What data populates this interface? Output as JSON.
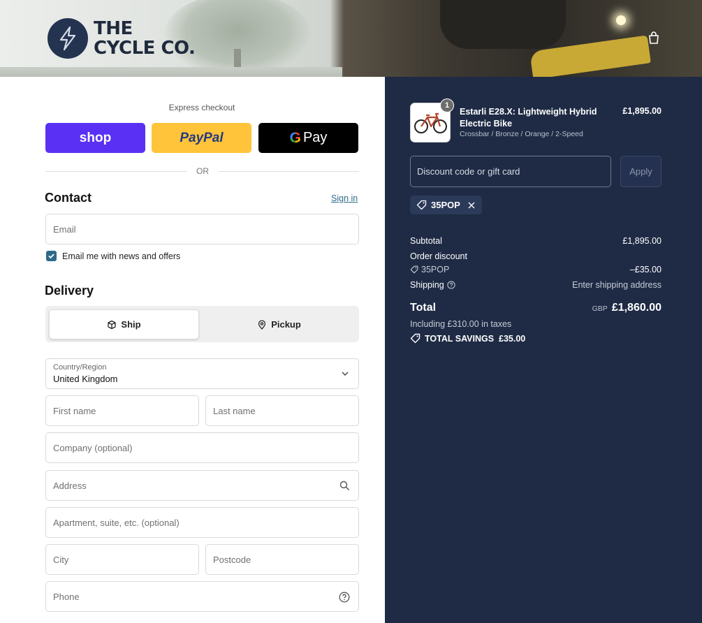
{
  "header": {
    "logo_line1": "THE",
    "logo_line2": "CYCLE CO."
  },
  "express": {
    "title": "Express checkout",
    "shop_label": "shop",
    "paypal_label": "PayPal",
    "gpay_label": "Pay",
    "or_label": "OR"
  },
  "contact": {
    "heading": "Contact",
    "signin": "Sign in",
    "email_placeholder": "Email",
    "newsletter_label": "Email me with news and offers",
    "newsletter_checked": true
  },
  "delivery": {
    "heading": "Delivery",
    "ship_label": "Ship",
    "pickup_label": "Pickup",
    "country_label": "Country/Region",
    "country_value": "United Kingdom",
    "first_name": "First name",
    "last_name": "Last name",
    "company": "Company (optional)",
    "address": "Address",
    "apartment": "Apartment, suite, etc. (optional)",
    "city": "City",
    "postcode": "Postcode",
    "phone": "Phone"
  },
  "summary": {
    "item": {
      "quantity": "1",
      "name": "Estarli E28.X: Lightweight Hybrid Electric Bike",
      "variant": "Crossbar / Bronze / Orange / 2-Speed",
      "price": "£1,895.00"
    },
    "discount_placeholder": "Discount code or gift card",
    "apply_label": "Apply",
    "applied_code": "35POP",
    "subtotal_label": "Subtotal",
    "subtotal_value": "£1,895.00",
    "order_discount_label": "Order discount",
    "order_discount_code": "35POP",
    "order_discount_value": "–£35.00",
    "shipping_label": "Shipping",
    "shipping_value": "Enter shipping address",
    "total_label": "Total",
    "currency": "GBP",
    "total_value": "£1,860.00",
    "taxes_note": "Including £310.00 in taxes",
    "savings": "TOTAL SAVINGS  £35.00"
  },
  "colors": {
    "summary_bg": "#1f2b45",
    "shop_purple": "#5a31f4",
    "paypal_yellow": "#ffc439",
    "accent": "#2d6a8a"
  }
}
